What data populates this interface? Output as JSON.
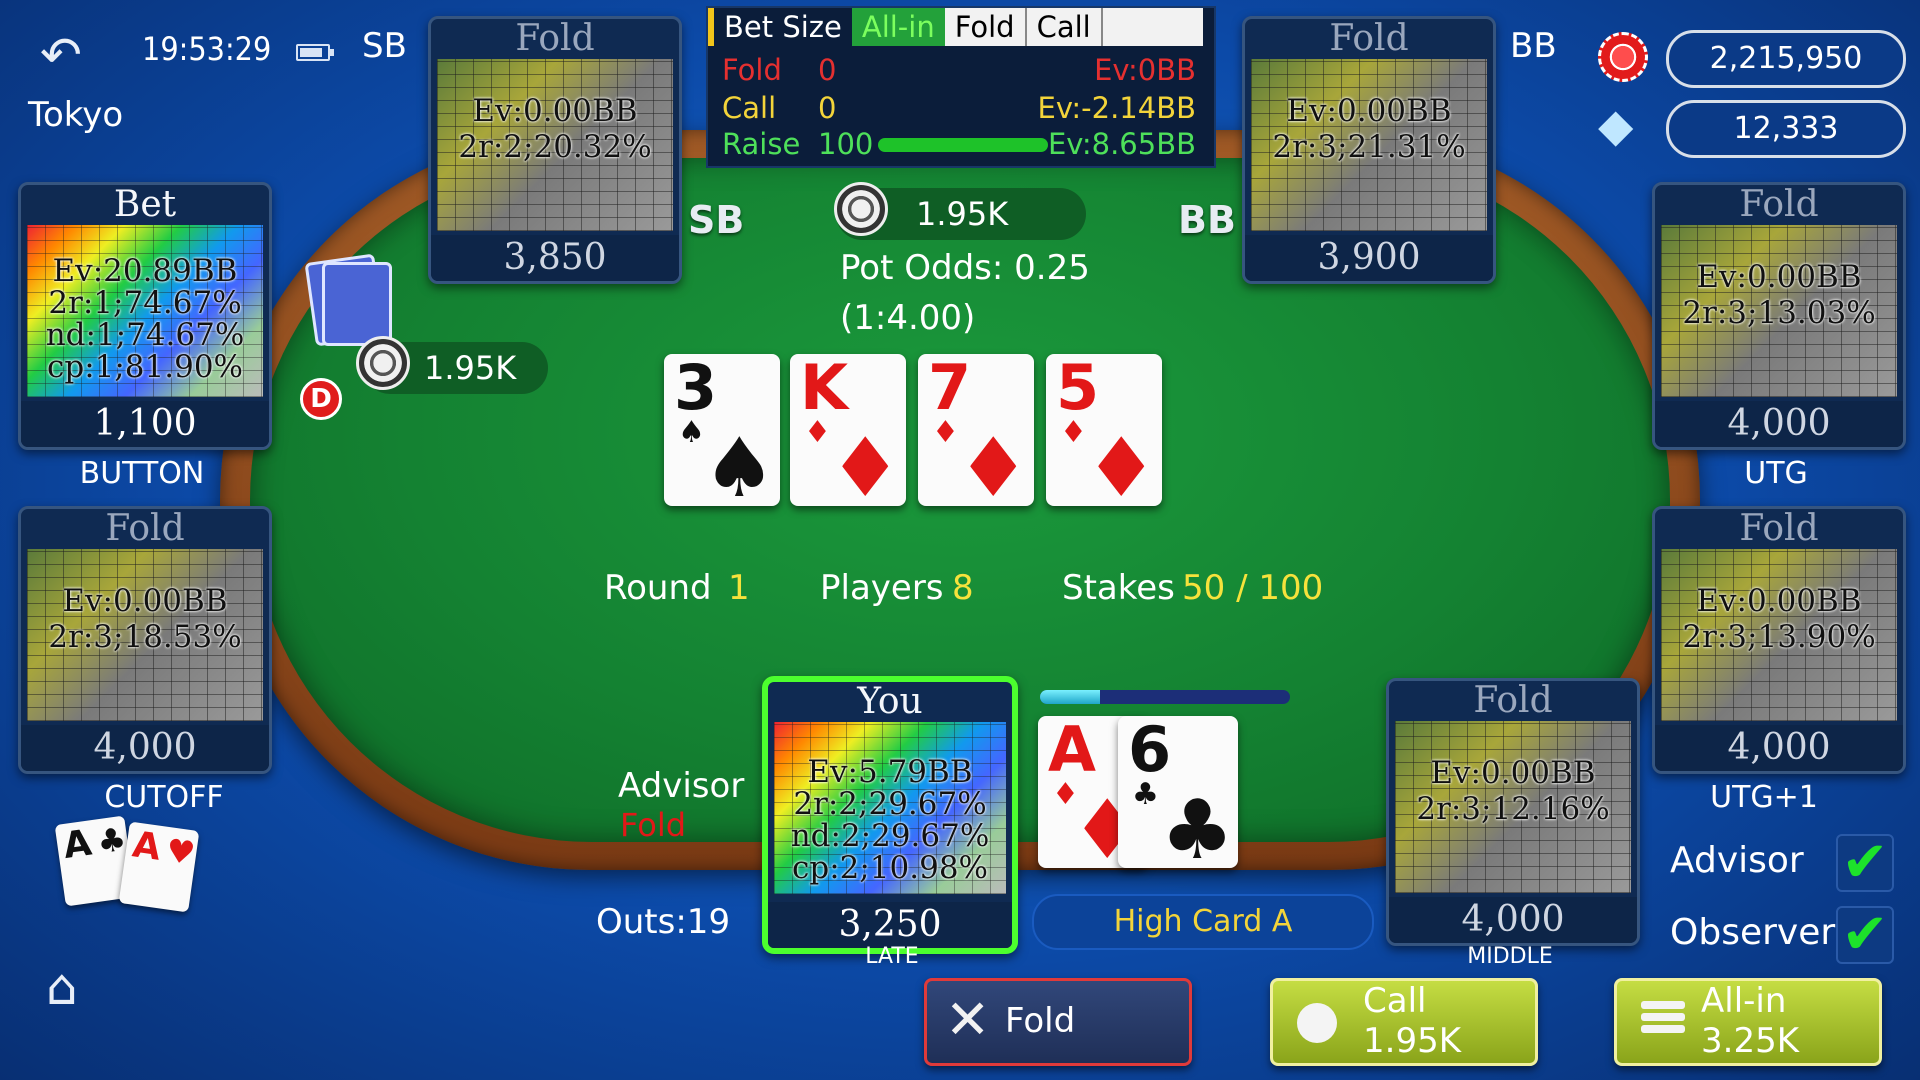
{
  "header": {
    "clock": "19:53:29",
    "city": "Tokyo",
    "sb_label": "SB",
    "bb_label": "BB"
  },
  "balances": {
    "chips": "2,215,950",
    "diamonds": "12,333"
  },
  "info_panel": {
    "tabs": [
      "Bet Size",
      "All-in",
      "Fold",
      "Call",
      ""
    ],
    "rows": [
      {
        "label": "Fold",
        "value": "0",
        "ev": "Ev:0BB"
      },
      {
        "label": "Call",
        "value": "0",
        "ev": "Ev:-2.14BB"
      },
      {
        "label": "Raise",
        "value": "100",
        "ev": "Ev:8.65BB"
      }
    ]
  },
  "seats": {
    "sb": {
      "action": "Fold",
      "stats": [
        "Ev:0.00BB",
        "2r:2;20.32%"
      ],
      "chips": "3,850"
    },
    "bb": {
      "action": "Fold",
      "stats": [
        "Ev:0.00BB",
        "2r:3;21.31%"
      ],
      "chips": "3,900"
    },
    "button": {
      "action": "Bet",
      "stats": [
        "Ev:20.89BB",
        "2r:1;74.67%",
        "nd:1;74.67%",
        "cp:1;81.90%"
      ],
      "chips": "1,100",
      "position": "BUTTON"
    },
    "utg": {
      "action": "Fold",
      "stats": [
        "Ev:0.00BB",
        "2r:3;13.03%"
      ],
      "chips": "4,000",
      "position": "UTG"
    },
    "cutoff": {
      "action": "Fold",
      "stats": [
        "Ev:0.00BB",
        "2r:3;18.53%"
      ],
      "chips": "4,000",
      "position": "CUTOFF"
    },
    "utg1": {
      "action": "Fold",
      "stats": [
        "Ev:0.00BB",
        "2r:3;13.90%"
      ],
      "chips": "4,000",
      "position": "UTG+1"
    },
    "you": {
      "action": "You",
      "stats": [
        "Ev:5.79BB",
        "2r:2;29.67%",
        "nd:2;29.67%",
        "cp:2;10.98%"
      ],
      "chips": "3,250",
      "position": "LATE"
    },
    "middle": {
      "action": "Fold",
      "stats": [
        "Ev:0.00BB",
        "2r:3;12.16%"
      ],
      "chips": "4,000",
      "position": "MIDDLE"
    }
  },
  "table": {
    "sb_tag": "SB",
    "bb_tag": "BB",
    "pot_bet": "1.95K",
    "button_bet": "1.95K",
    "pot_odds": "Pot Odds: 0.25",
    "pot_ratio": "(1:4.00)",
    "dealer": "D",
    "board": [
      {
        "rank": "3",
        "suit": "♠",
        "color": "black"
      },
      {
        "rank": "K",
        "suit": "♦",
        "color": "red"
      },
      {
        "rank": "7",
        "suit": "♦",
        "color": "red"
      },
      {
        "rank": "5",
        "suit": "♦",
        "color": "red"
      }
    ],
    "round_label": "Round",
    "round_value": "1",
    "players_label": "Players",
    "players_value": "8",
    "stakes_label": "Stakes",
    "stakes_value": "50 / 100"
  },
  "hero": {
    "advisor_label": "Advisor",
    "advisor_suggestion": "Fold",
    "outs": "Outs:19",
    "hole_cards": [
      {
        "rank": "A",
        "suit": "♦",
        "color": "red"
      },
      {
        "rank": "6",
        "suit": "♣",
        "color": "black"
      }
    ],
    "hand_strength": "High Card A",
    "timer_fraction": 0.24
  },
  "cutoff_cards": [
    {
      "rank": "A",
      "suit": "♣",
      "color": "black"
    },
    {
      "rank": "A",
      "suit": "♥",
      "color": "red"
    }
  ],
  "toggles": {
    "advisor": "Advisor",
    "observer": "Observer"
  },
  "actions": {
    "fold": "Fold",
    "call": "Call",
    "call_amount": "1.95K",
    "allin": "All-in",
    "allin_amount": "3.25K"
  },
  "colors": {
    "felt": "#148232",
    "rail": "#8a4a1e",
    "background": "#0c4aa8",
    "hero_border": "#4cff2e"
  }
}
